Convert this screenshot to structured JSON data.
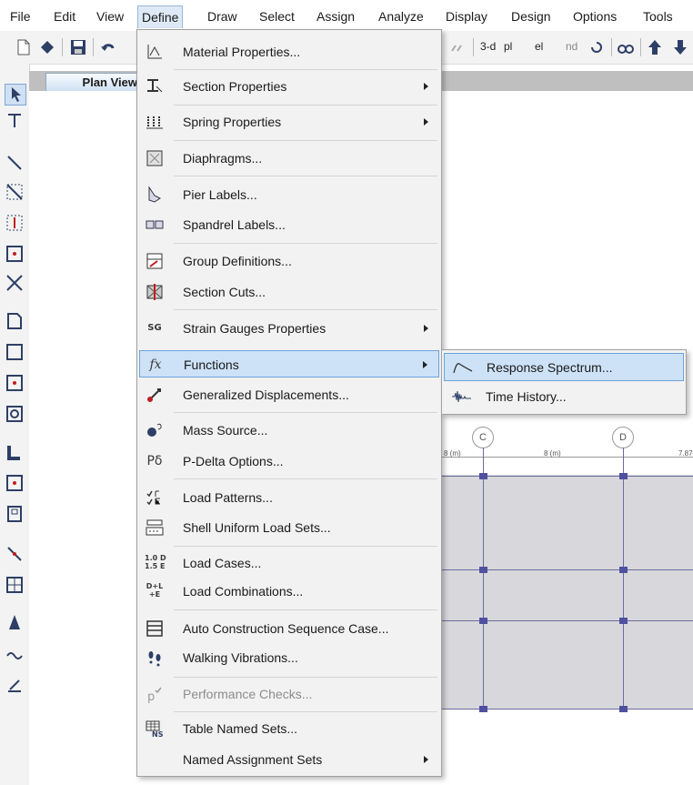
{
  "menubar": {
    "items": [
      "File",
      "Edit",
      "View",
      "Define",
      "Draw",
      "Select",
      "Assign",
      "Analyze",
      "Display",
      "Design",
      "Options",
      "Tools"
    ],
    "open": "Define"
  },
  "toolbar": {
    "view_3d": "3-d",
    "view_plan": "pl",
    "view_elev": "el",
    "view_nd": "nd"
  },
  "tab": {
    "label": "Plan View"
  },
  "plan": {
    "bubbles": [
      "C",
      "D"
    ],
    "dims": [
      "8 (m)",
      "8 (m)",
      "7.87"
    ]
  },
  "define_menu": [
    {
      "label": "Material Properties...",
      "icon": "material-properties-icon",
      "submenu": false
    },
    {
      "label": "Section Properties",
      "icon": "section-properties-icon",
      "submenu": true
    },
    {
      "label": "Spring Properties",
      "icon": "spring-properties-icon",
      "submenu": true
    },
    {
      "label": "Diaphragms...",
      "icon": "diaphragm-icon",
      "submenu": false
    },
    {
      "label": "Pier Labels...",
      "icon": "pier-labels-icon",
      "submenu": false
    },
    {
      "label": "Spandrel Labels...",
      "icon": "spandrel-labels-icon",
      "submenu": false
    },
    {
      "label": "Group Definitions...",
      "icon": "group-definitions-icon",
      "submenu": false
    },
    {
      "label": "Section Cuts...",
      "icon": "section-cuts-icon",
      "submenu": false
    },
    {
      "label": "Strain Gauges Properties",
      "icon": "strain-gauge-icon",
      "submenu": true
    },
    {
      "label": "Functions",
      "icon": "functions-icon",
      "submenu": true,
      "highlighted": true
    },
    {
      "label": "Generalized Displacements...",
      "icon": "generalized-displacement-icon",
      "submenu": false
    },
    {
      "label": "Mass Source...",
      "icon": "mass-source-icon",
      "submenu": false
    },
    {
      "label": "P-Delta Options...",
      "icon": "p-delta-icon",
      "submenu": false
    },
    {
      "label": "Load Patterns...",
      "icon": "load-patterns-icon",
      "submenu": false
    },
    {
      "label": "Shell Uniform Load Sets...",
      "icon": "shell-load-sets-icon",
      "submenu": false
    },
    {
      "label": "Load Cases...",
      "icon": "load-cases-icon",
      "submenu": false
    },
    {
      "label": "Load Combinations...",
      "icon": "load-combinations-icon",
      "submenu": false
    },
    {
      "label": "Auto Construction Sequence Case...",
      "icon": "construction-sequence-icon",
      "submenu": false
    },
    {
      "label": "Walking Vibrations...",
      "icon": "walking-vibrations-icon",
      "submenu": false
    },
    {
      "label": "Performance Checks...",
      "icon": "performance-checks-icon",
      "submenu": false,
      "disabled": true
    },
    {
      "label": "Table Named Sets...",
      "icon": "table-named-sets-icon",
      "submenu": false
    },
    {
      "label": "Named Assignment Sets",
      "icon": "",
      "submenu": true
    }
  ],
  "icon_text": {
    "pdelta": "Pδ",
    "sg": "SG",
    "load_cases": "1.0 D\n1.5 E",
    "load_combo": "D+L\n+E",
    "fx": "fx",
    "ns": "NS"
  },
  "functions_submenu": [
    {
      "label": "Response Spectrum...",
      "icon": "response-spectrum-icon",
      "highlighted": true
    },
    {
      "label": "Time History...",
      "icon": "time-history-icon"
    }
  ]
}
